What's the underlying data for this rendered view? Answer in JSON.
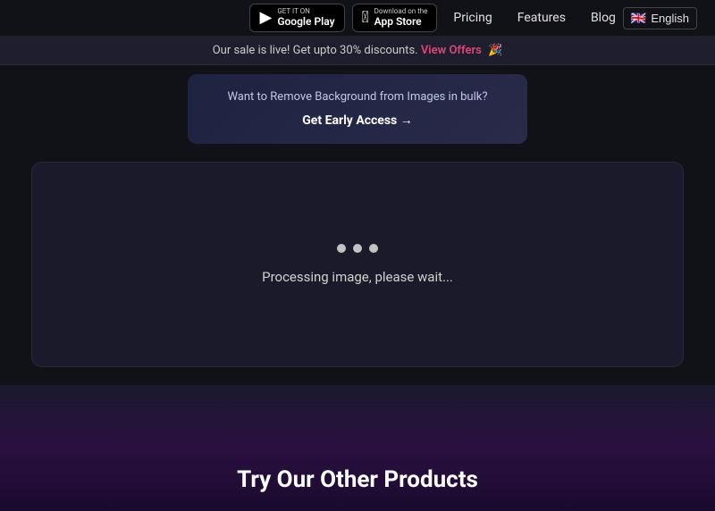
{
  "nav": {
    "google_play_small": "GET IT ON",
    "google_play_name": "Google Play",
    "app_store_small": "Download on the",
    "app_store_name": "App Store",
    "pricing": "Pricing",
    "features": "Features",
    "blog": "Blog",
    "language": "English"
  },
  "sale_banner": {
    "text": "Our sale is live! Get upto 30% discounts.",
    "link_text": "View Offers",
    "emoji": "🎉"
  },
  "upload_card": {
    "text": "Want to Remove Background from Images in bulk?",
    "cta": "Get Early Access →"
  },
  "processing": {
    "text": "Processing image, please wait..."
  },
  "bottom": {
    "title": "Try Our Other Products"
  }
}
